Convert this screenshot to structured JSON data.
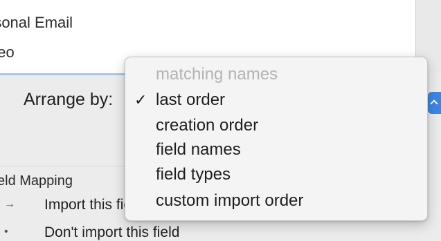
{
  "list": {
    "items": [
      "rsonal Email",
      "deo"
    ]
  },
  "arrange": {
    "label": "Arrange by:"
  },
  "popup_menu": {
    "items": [
      {
        "label": "matching names",
        "enabled": false,
        "checked": false
      },
      {
        "label": "last order",
        "enabled": true,
        "checked": true
      },
      {
        "label": "creation order",
        "enabled": true,
        "checked": false
      },
      {
        "label": "field names",
        "enabled": true,
        "checked": false
      },
      {
        "label": "field types",
        "enabled": true,
        "checked": false
      },
      {
        "label": "custom import order",
        "enabled": true,
        "checked": false
      }
    ],
    "check_glyph": "✓"
  },
  "field_mapping": {
    "title": "eld Mapping",
    "rows": [
      {
        "icon": "arrow-import-icon",
        "glyph": "→",
        "label": "Import this field"
      },
      {
        "icon": "no-import-icon",
        "glyph": "•",
        "label": "Don't import this field"
      }
    ]
  },
  "colors": {
    "accent": "#3b86e6",
    "selection_border": "#a9c6e8",
    "disabled_text": "#b3b3b3"
  }
}
